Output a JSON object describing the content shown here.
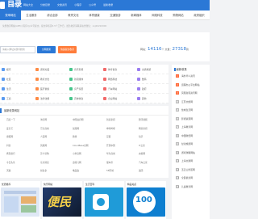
{
  "header": {
    "logo_text": "目录",
    "top_links": [
      "首页",
      "网站大全",
      "分类目录",
      "文章资讯",
      "小程序",
      "公众号",
      "最新收录"
    ]
  },
  "nav": {
    "items": [
      "快审网站",
      "生活服务",
      "综合全部",
      "教育文化",
      "体育健康",
      "交通旅游",
      "新闻媒体",
      "网络科技",
      "购物网站",
      "政府组织"
    ]
  },
  "notice": "免费收录网站/APP/小程序/公众号提交，提交审核需3-5个工作日，加急收录请联系站长微信：xxj20210000",
  "search": {
    "placeholder": "请输入网址关键词搜索",
    "submit_label": "全网搜索",
    "fast_label": "快速提交收录"
  },
  "stats": {
    "label1": "网站：",
    "count1": "14116",
    "unit1": "个",
    "label2": "文章：",
    "count2": "27318",
    "unit2": "篇"
  },
  "categories": {
    "rows": [
      [
        "娱乐",
        "游戏动漫",
        "音乐影视",
        "体育健身",
        "交通旅游"
      ],
      [
        "社区",
        "教育文化",
        "新闻媒体",
        "网络科技",
        "数码"
      ],
      [
        "生活",
        "医疗健康",
        "房产家居",
        "汽车网站",
        "政府"
      ],
      [
        "工商",
        "法律法规",
        "农林牧渔",
        "企业网站",
        "其他"
      ]
    ],
    "colors": [
      "#5b9bf0",
      "#fe8a44",
      "#47c68c",
      "#f26a6a",
      "#9a7cf0"
    ]
  },
  "sites": {
    "heading": "最新收录网站",
    "rows": [
      [
        "百度一下",
        "淘宝网",
        "中国政府网",
        "新浪新闻",
        "腾讯视频"
      ],
      [
        "爱奇艺",
        "京东商城",
        "优酷网",
        "哔哩哔哩",
        "网易新闻"
      ],
      [
        "搜狐网",
        "人民网",
        "微博",
        "豆瓣",
        "知乎"
      ],
      [
        "抖音",
        "凤凰网",
        "CloudBase官网",
        "开源中国",
        "IT之家"
      ],
      [
        "携程旅行",
        "苏宁易购",
        "小米官网",
        "华为商城",
        "央视网"
      ],
      [
        "今日头条",
        "东方财富",
        "去哪儿网",
        "懂车帝",
        "汽车之家"
      ],
      [
        "天猫",
        "拼多多",
        "唯品会",
        "58同城",
        "美团"
      ]
    ]
  },
  "ranking": {
    "title": "最新收录",
    "items": [
      "海外华人资讯",
      "远程办公平台网站",
      "凤凰新闻资讯网",
      "江苏文旅网",
      "盐城生活网",
      "影视资源网",
      "上海教育网",
      "中国财经网",
      "甘肃旅游网",
      "游戏攻略网站",
      "上海交通网",
      "五云山景区网",
      "全民健身网",
      "儿童教育网"
    ]
  },
  "thumbs": {
    "captions": [
      "优质推荐",
      "快乐网站",
      "生活百科",
      "精品站点"
    ],
    "big_text": [
      "",
      "便民",
      "",
      "100"
    ]
  }
}
